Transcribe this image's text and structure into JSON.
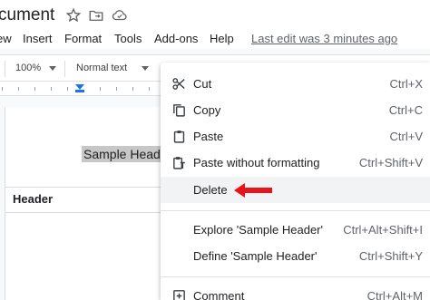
{
  "title": {
    "doc_name": "cument",
    "icons": [
      "star-icon",
      "move-to-folder-icon",
      "cloud-status-icon"
    ]
  },
  "menu": {
    "items": [
      "ew",
      "Insert",
      "Format",
      "Tools",
      "Add-ons",
      "Help"
    ],
    "last_edit": "Last edit was 3 minutes ago"
  },
  "toolbar": {
    "zoom": "100%",
    "style": "Normal text"
  },
  "document": {
    "selected_text": "Sample Header",
    "table_header": "Header"
  },
  "context_menu": {
    "items": [
      {
        "label": "Cut",
        "shortcut": "Ctrl+X",
        "icon": "scissors-icon"
      },
      {
        "label": "Copy",
        "shortcut": "Ctrl+C",
        "icon": "copy-icon"
      },
      {
        "label": "Paste",
        "shortcut": "Ctrl+V",
        "icon": "clipboard-icon"
      },
      {
        "label": "Paste without formatting",
        "shortcut": "Ctrl+Shift+V",
        "icon": "paste-plain-icon"
      },
      {
        "label": "Delete",
        "shortcut": "",
        "icon": ""
      },
      {
        "label": "Explore 'Sample Header'",
        "shortcut": "Ctrl+Alt+Shift+I",
        "icon": ""
      },
      {
        "label": "Define 'Sample Header'",
        "shortcut": "Ctrl+Shift+Y",
        "icon": ""
      },
      {
        "label": "Comment",
        "shortcut": "Ctrl+Alt+M",
        "icon": "add-comment-icon"
      }
    ]
  },
  "colors": {
    "accent": "#1a73e8",
    "annotation_arrow": "#e8141c",
    "selection": "#c7c7c7"
  }
}
